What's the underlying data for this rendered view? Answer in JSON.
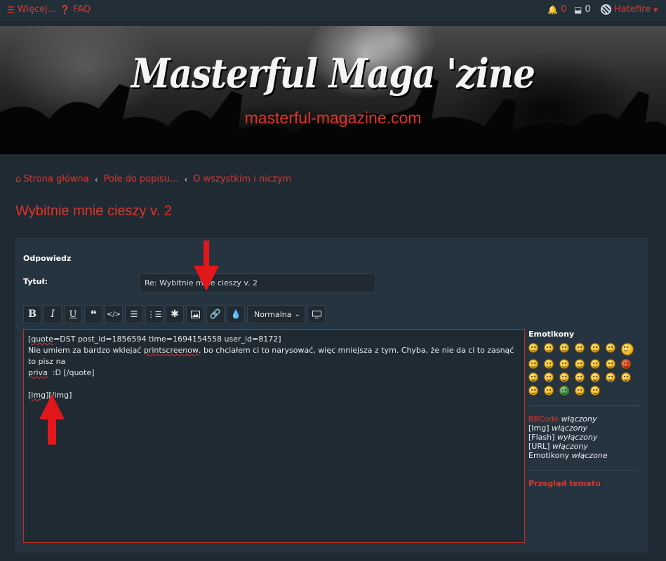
{
  "topbar": {
    "more_label": "Więcej...",
    "faq_label": "FAQ",
    "notifications_count": "0",
    "messages_count": "0",
    "username": "Hatefire"
  },
  "banner": {
    "title": "Masterful Maga 'zine",
    "url": "masterful-magazine.com"
  },
  "breadcrumb": {
    "items": [
      "Strona główna",
      "Pole do popisu...",
      "O wszystkim i niczym"
    ]
  },
  "page": {
    "title": "Wybitnie mnie cieszy v. 2"
  },
  "form": {
    "heading": "Odpowiedz",
    "subject_label": "Tytuł:",
    "subject_value": "Re: Wybitnie mnie cieszy v. 2",
    "font_size_selected": "Normalna"
  },
  "editor": {
    "line1_a": "[",
    "line1_quote": "quote",
    "line1_b": "=DST post_id=1856594 time=1694154558 user_id=8172]",
    "line2_a": "Nie umiem za bardzo wklejać ",
    "line2_sq": "printscreenow",
    "line2_b": ", bo chciałem ci to narysować, więc mniejsza z tym. Chyba, że nie da ci to zasnąć to pisz na",
    "line3_sq": "priva",
    "line3_b": "  :D [/quote]",
    "line5_a": "[",
    "line5_img": "img",
    "line5_b": "][/img]"
  },
  "sidebar": {
    "emoticons_title": "Emotikony",
    "bbcode_label": "BBCode",
    "bbcode_state": "włączony",
    "img_label": "[Img]",
    "img_state": "włączony",
    "flash_label": "[Flash]",
    "flash_state": "wyłączony",
    "url_label": "[URL]",
    "url_state": "włączony",
    "emo_label": "Emotikony",
    "emo_state": "włączone",
    "topic_review": "Przegląd tematu"
  },
  "colors": {
    "accent": "#e0352b",
    "background": "#1f2a33",
    "panel": "#263440"
  }
}
